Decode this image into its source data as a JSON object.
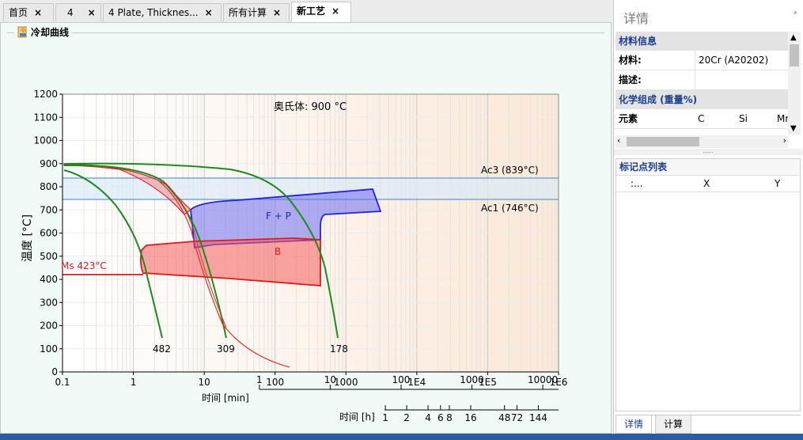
{
  "tabs": [
    {
      "label": "首页",
      "close": "×"
    },
    {
      "label": "4",
      "close": "×"
    },
    {
      "label": "4   Plate, Thicknes...",
      "close": "×"
    },
    {
      "label": "所有计算",
      "close": "×"
    },
    {
      "label": "新工艺",
      "close": "×"
    }
  ],
  "group": {
    "title": "冷却曲线"
  },
  "chart": {
    "austenite_label": "奥氏体: 900 °C",
    "y_axis_label": "温度 [°C]",
    "y_ticks": [
      "0",
      "100",
      "200",
      "300",
      "400",
      "500",
      "600",
      "700",
      "800",
      "900",
      "1000",
      "1100",
      "1200"
    ],
    "x_ticks": [
      "0.1",
      "1",
      "10",
      "100",
      "1000",
      "1E4",
      "1E5",
      "1E6"
    ],
    "min_axis_label": "时间 [min]",
    "min_ticks": [
      "1",
      "10",
      "100",
      "1000",
      "10000"
    ],
    "hour_axis_label": "时间 [h]",
    "hour_ticks": [
      "1",
      "2",
      "4",
      "6",
      "8",
      "16",
      "48",
      "72",
      "144"
    ],
    "ac3_label": "Ac3 (839°C)",
    "ac1_label": "Ac1 (746°C)",
    "ms_label": "Ms 423°C",
    "fp_label": "F + P",
    "b_label": "B",
    "curve_labels": [
      "482",
      "309",
      "178"
    ]
  },
  "chart_data": {
    "type": "line",
    "xscale": "log",
    "xlim": [
      0.1,
      1000000
    ],
    "ylim": [
      0,
      1200
    ],
    "ylabel": "温度 [°C]",
    "austenitizing_temperature": 900,
    "Ac3": 839,
    "Ac1": 746,
    "Ms": 423,
    "cooling_curves": [
      {
        "label": "482",
        "x": [
          0.1,
          0.3,
          0.6,
          1.0,
          1.5,
          2.0,
          2.6
        ],
        "y": [
          870,
          770,
          600,
          450,
          320,
          210,
          150
        ]
      },
      {
        "label": "309",
        "x": [
          0.1,
          1,
          3,
          5,
          8,
          12,
          20
        ],
        "y": [
          900,
          895,
          860,
          760,
          520,
          300,
          150
        ]
      },
      {
        "label": "178",
        "x": [
          0.1,
          10,
          40,
          100,
          200,
          400,
          800
        ],
        "y": [
          900,
          897,
          880,
          820,
          700,
          500,
          150
        ]
      }
    ],
    "regions": [
      {
        "label": "F + P",
        "color": "#3a3ae0"
      },
      {
        "label": "B",
        "color": "#e02020"
      }
    ],
    "hardness": [
      482,
      309,
      178
    ]
  },
  "right_panel": {
    "title": "详情",
    "pin": "ᵃ",
    "material_section": "材料信息",
    "material_key": "材料:",
    "material_value": "20Cr (A20202)",
    "desc_key": "描述:",
    "desc_value": "",
    "chem_section": "化学组成  (重量%)",
    "element_key": "元素",
    "elements": [
      "C",
      "Si",
      "Mr"
    ],
    "splitter": ".....",
    "marker_title": "标记点列表",
    "marker_cols": [
      ":...",
      "X",
      "Y"
    ],
    "bottom_tabs": [
      "详情",
      "计算"
    ]
  },
  "colors": {
    "fp": "#3a3ae0",
    "bainite": "#e02020",
    "cooling": "#1e8a1e",
    "ac_band": "#6fa8dc"
  }
}
